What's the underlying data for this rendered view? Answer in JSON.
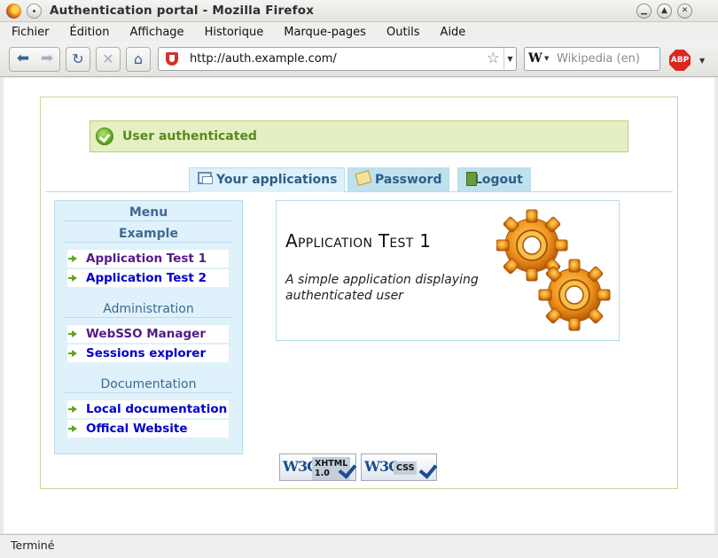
{
  "window": {
    "title": "Authentication portal - Mozilla Firefox"
  },
  "menubar": {
    "items": [
      "Fichier",
      "Édition",
      "Affichage",
      "Historique",
      "Marque-pages",
      "Outils",
      "Aide"
    ]
  },
  "navbar": {
    "url": "http://auth.example.com/",
    "search_placeholder": "Wikipedia (en)",
    "search_engine": "W",
    "adblock_label": "ABP"
  },
  "page": {
    "auth_message": "User authenticated",
    "tabs": [
      {
        "label": "Your applications",
        "active": true
      },
      {
        "label": "Password",
        "active": false
      },
      {
        "label": "Logout",
        "active": false
      }
    ],
    "menu": {
      "title": "Menu",
      "categories": [
        {
          "title": "Example",
          "items": [
            {
              "label": "Application Test 1",
              "visited": true
            },
            {
              "label": "Application Test 2",
              "visited": false
            }
          ]
        },
        {
          "title": "Administration",
          "items": [
            {
              "label": "WebSSO Manager",
              "visited": true
            },
            {
              "label": "Sessions explorer",
              "visited": false
            }
          ]
        },
        {
          "title": "Documentation",
          "items": [
            {
              "label": "Local documentation",
              "visited": false
            },
            {
              "label": "Offical Website",
              "visited": false
            }
          ]
        }
      ]
    },
    "app_card": {
      "title": "Application Test 1",
      "description": "A simple application displaying authenticated user",
      "icon": "gears-icon"
    },
    "badges": [
      {
        "logo": "W3C",
        "label_line1": "XHTML",
        "label_line2": "1.0"
      },
      {
        "logo": "W3C",
        "label_line1": "CSS",
        "label_line2": ""
      }
    ]
  },
  "statusbar": {
    "text": "Terminé"
  },
  "colors": {
    "tab_bg": "#bfe1ee",
    "sidebar_bg": "#dff1fa",
    "auth_bg": "#e4f0c4",
    "auth_text": "#5a8a1a",
    "link": "#0000cc",
    "visited": "#551a8b"
  }
}
